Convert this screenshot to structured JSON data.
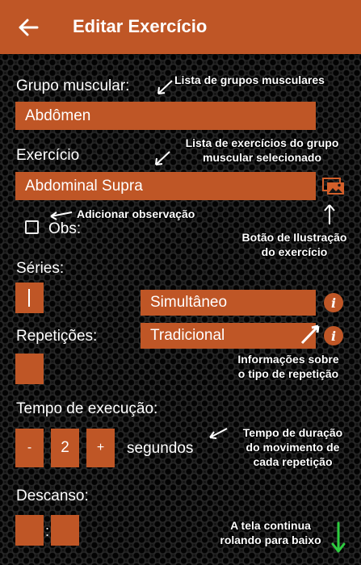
{
  "appbar": {
    "title": "Editar Exercício"
  },
  "grupo": {
    "label": "Grupo muscular:",
    "value": "Abdômen"
  },
  "exercicio": {
    "label": "Exercício",
    "value": "Abdominal Supra"
  },
  "obs": {
    "label": "Obs:"
  },
  "series": {
    "label": "Séries:"
  },
  "repeticoes": {
    "label": "Repetições:"
  },
  "tipo_repeticao": {
    "option1": "Simultâneo",
    "option2": "Tradicional"
  },
  "tempo_execucao": {
    "label": "Tempo de execução:",
    "minus": "-",
    "value": "2",
    "plus": "+",
    "unit": "segundos"
  },
  "descanso": {
    "label": "Descanso:",
    "separator": ":"
  },
  "annotations": {
    "grupos": "Lista de grupos musculares",
    "exercicios_l1": "Lista de exercícios do grupo",
    "exercicios_l2": "muscular selecionado",
    "observacao": "Adicionar observação",
    "ilustracao_l1": "Botão de Ilustração",
    "ilustracao_l2": "do exercício",
    "info_l1": "Informações sobre",
    "info_l2": "o tipo de repetição",
    "tempo_l1": "Tempo de duração",
    "tempo_l2": "do movimento de",
    "tempo_l3": "cada repetição",
    "scroll_l1": "A tela continua",
    "scroll_l2": "rolando para baixo"
  },
  "colors": {
    "accent": "#bf5626",
    "background": "#141414",
    "text": "#ffffff",
    "scroll_arrow": "#2ecc40"
  },
  "icons": [
    "back-arrow-icon",
    "image-gallery-icon",
    "info-icon",
    "checkbox-icon",
    "down-arrow-icon"
  ]
}
